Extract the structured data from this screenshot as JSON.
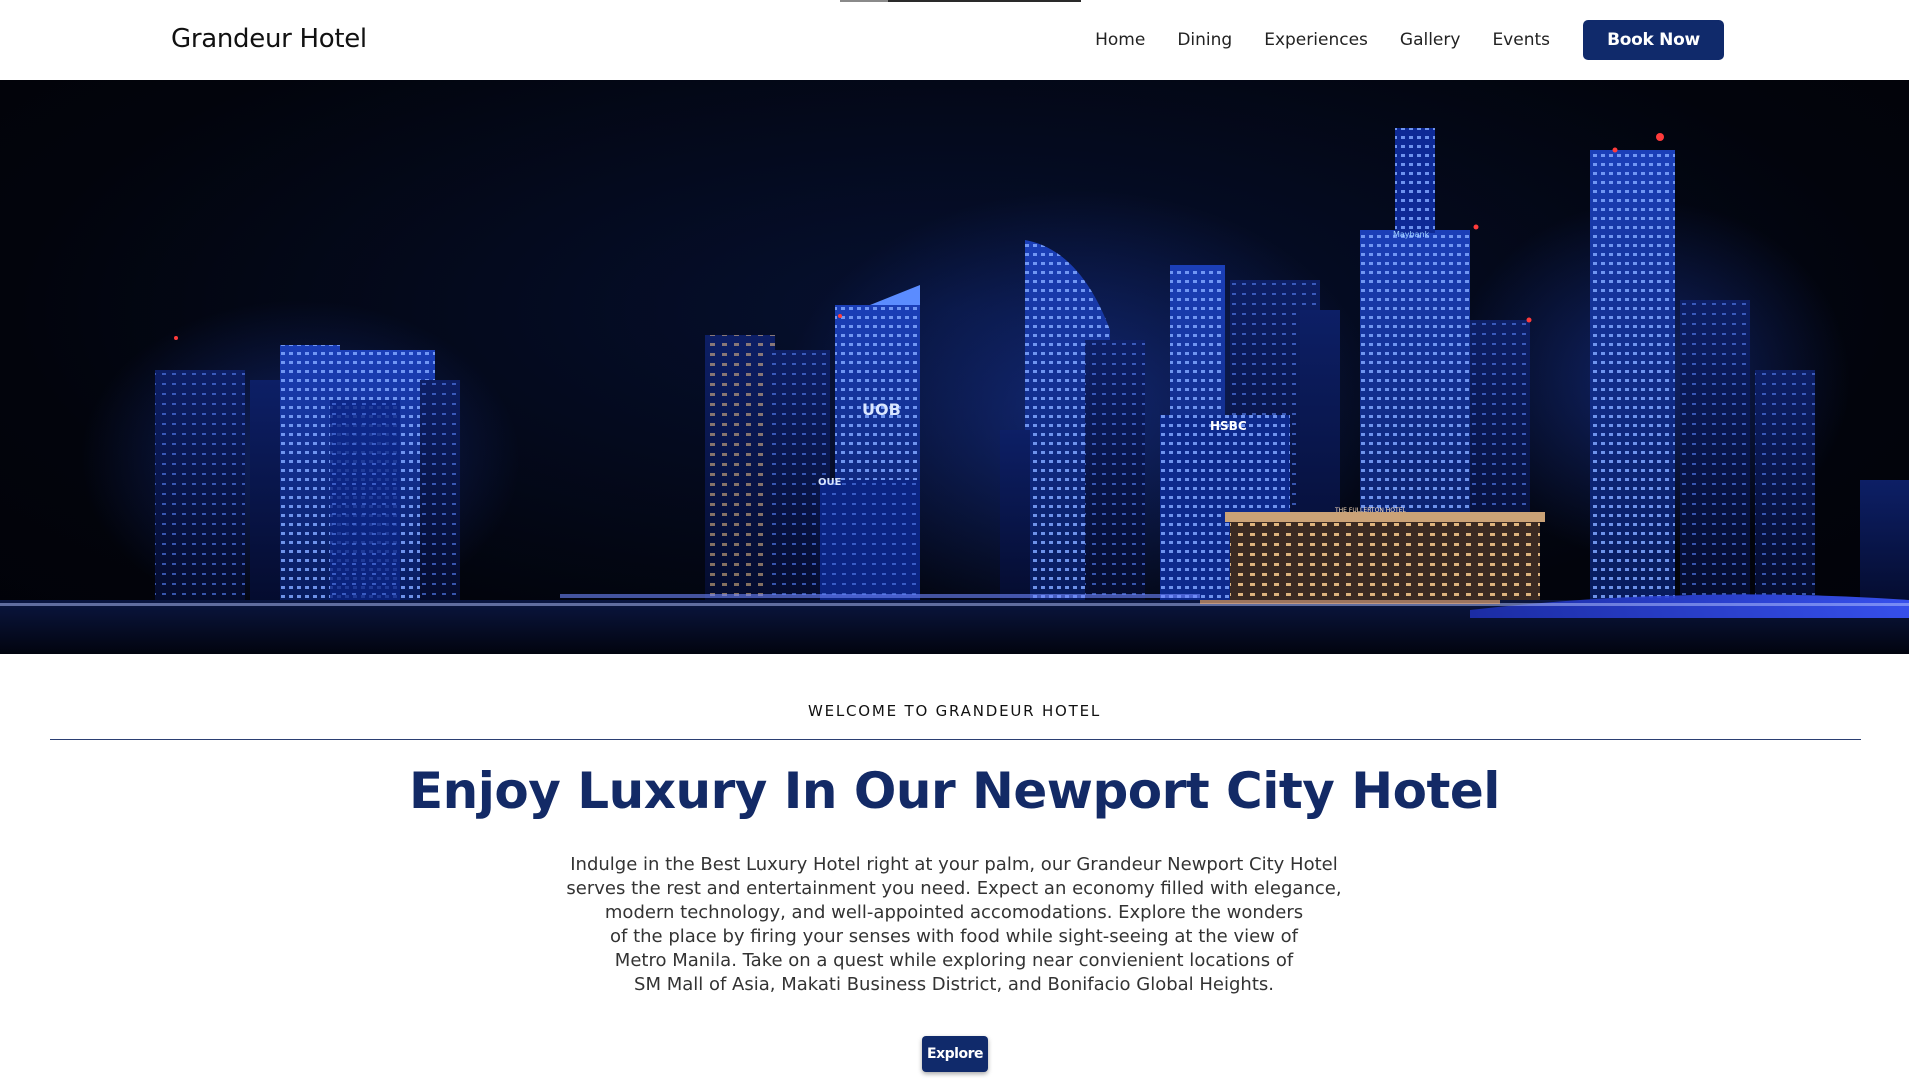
{
  "brand": {
    "name": "Grandeur Hotel"
  },
  "nav": {
    "items": [
      {
        "label": "Home"
      },
      {
        "label": "Dining"
      },
      {
        "label": "Experiences"
      },
      {
        "label": "Gallery"
      },
      {
        "label": "Events"
      }
    ],
    "cta_label": "Book Now"
  },
  "hero": {
    "image": "night-city-skyline-image",
    "signs": [
      "HSBC",
      "Maybank",
      "UOB",
      "OUE",
      "THE FULLERTON HOTEL"
    ]
  },
  "intro": {
    "eyebrow": "WELCOME TO GRANDEUR HOTEL",
    "headline": "Enjoy Luxury In Our Newport City Hotel",
    "body_lines": [
      "Indulge in the Best Luxury Hotel right at your palm, our Grandeur Newport City Hotel",
      "serves the rest and entertainment you need. Expect an economy filled with elegance,",
      "modern technology, and well-appointed accomodations. Explore the wonders",
      "of the place by firing your senses with food while sight-seeing at the view of",
      "Metro Manila. Take on a quest while exploring near convienient locations of",
      "SM Mall of Asia, Makati Business District, and Bonifacio Global Heights."
    ],
    "button_label": "Explore"
  },
  "colors": {
    "brand_navy": "#102a6b",
    "headline_navy": "#132a66",
    "hero_bg": "#02040c"
  }
}
